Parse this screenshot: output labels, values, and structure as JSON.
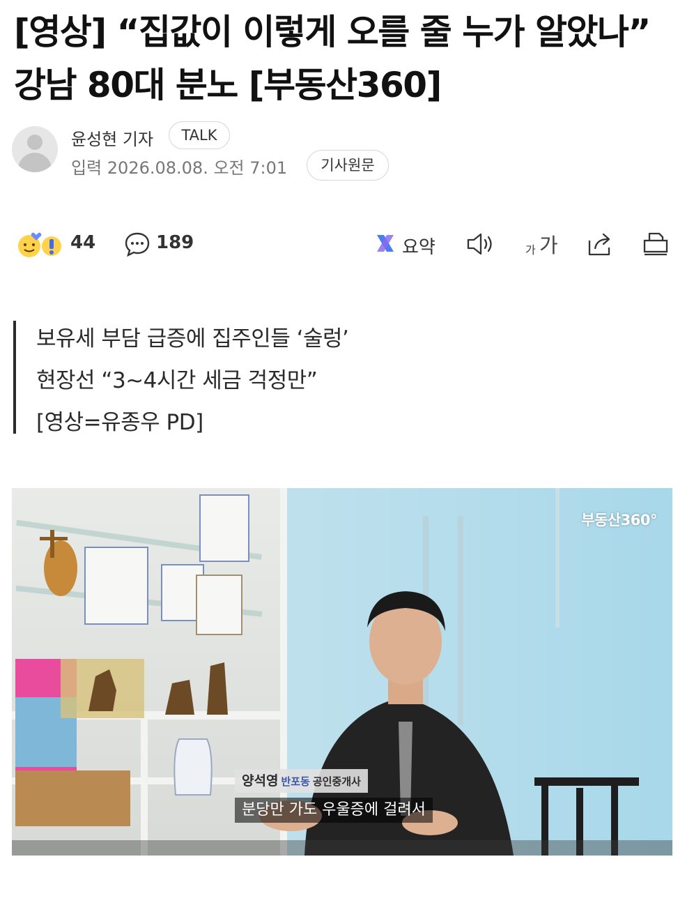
{
  "article": {
    "title": "[영상] “집값이 이렇게 오를 줄 누가 알았나” 강남 80대 분노 [부동산360]",
    "reporter": "윤성현 기자",
    "talk_label": "TALK",
    "published": "입력 2026.08.08. 오전 7:01",
    "original_label": "기사원문"
  },
  "toolbar": {
    "reaction_count": "44",
    "comment_count": "189",
    "summary_label": "요약",
    "font_small": "가",
    "font_large": "가"
  },
  "subtitles": [
    "보유세 부담 급증에 집주인들 ‘술렁’",
    "현장선 “3~4시간 세금 걱정만”",
    "[영상=유종우 PD]"
  ],
  "video": {
    "watermark": "부동산360°",
    "name": "양석영",
    "place": "반포동",
    "role": "공인중개사",
    "caption": "분당만 가도 우울증에 걸려서"
  },
  "colors": {
    "summary_accent": "#4a7cf5",
    "lower_third_place": "#3f56a8"
  }
}
